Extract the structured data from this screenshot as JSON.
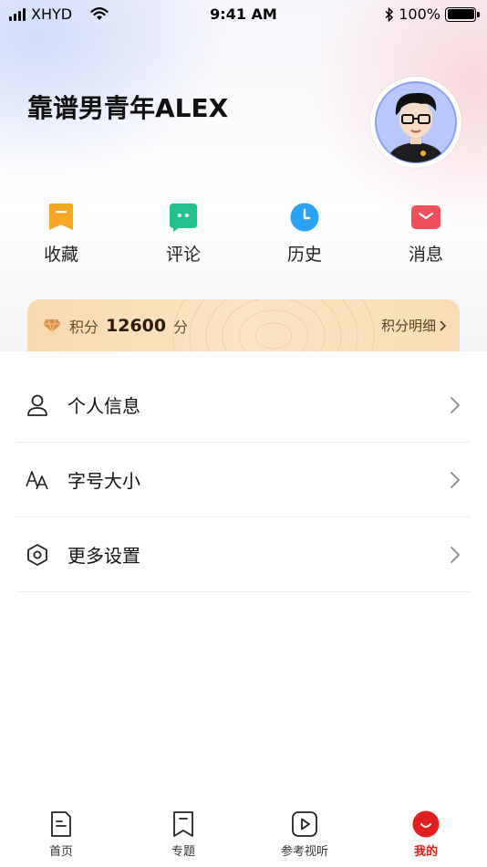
{
  "status_bar": {
    "carrier": "XHYD",
    "time": "9:41 AM",
    "battery": "100%"
  },
  "profile": {
    "username": "靠谱男青年ALEX"
  },
  "quick_actions": [
    {
      "label": "收藏",
      "icon": "bookmark-icon",
      "color": "#f7a823"
    },
    {
      "label": "评论",
      "icon": "comment-icon",
      "color": "#22c08f"
    },
    {
      "label": "历史",
      "icon": "clock-icon",
      "color": "#2aa3f5"
    },
    {
      "label": "消息",
      "icon": "mail-icon",
      "color": "#f0505a"
    }
  ],
  "points": {
    "label": "积分",
    "value": "12600",
    "unit": "分",
    "detail_link": "积分明细"
  },
  "settings": [
    {
      "label": "个人信息",
      "icon": "person-icon"
    },
    {
      "label": "字号大小",
      "icon": "font-size-icon"
    },
    {
      "label": "更多设置",
      "icon": "hexagon-settings-icon"
    }
  ],
  "tab_bar": [
    {
      "label": "首页",
      "icon": "document-icon",
      "active": false
    },
    {
      "label": "专题",
      "icon": "bookmark-outline-icon",
      "active": false
    },
    {
      "label": "参考视听",
      "icon": "play-icon",
      "active": false
    },
    {
      "label": "我的",
      "icon": "smile-icon",
      "active": true
    }
  ],
  "colors": {
    "accent_red": "#e02020",
    "points_card": "#f9dcb6"
  }
}
